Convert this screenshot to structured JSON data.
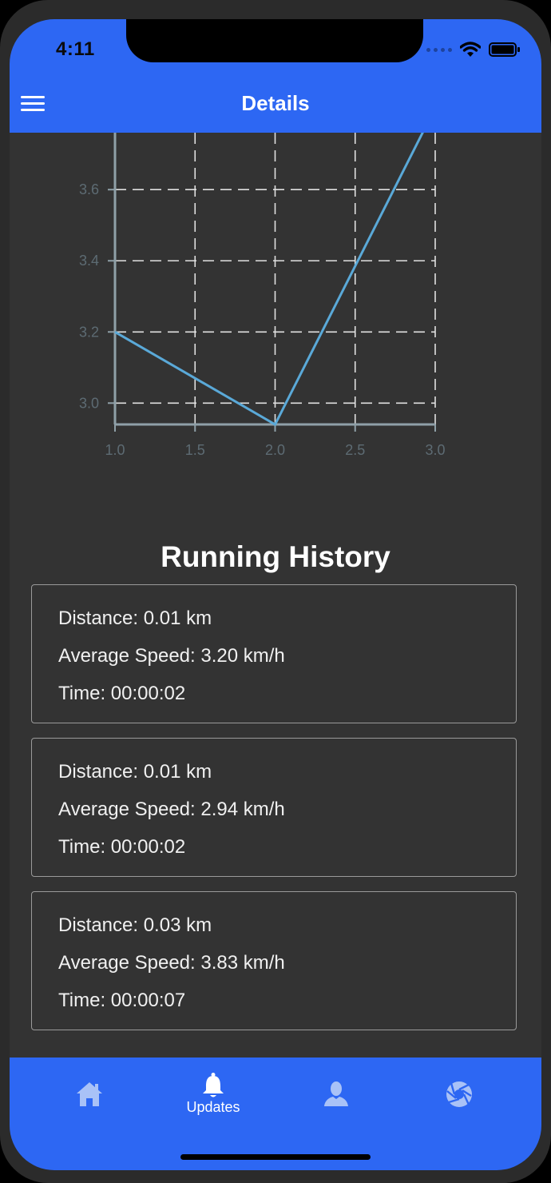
{
  "status_bar": {
    "time": "4:11"
  },
  "header": {
    "title": "Details"
  },
  "chart_data": {
    "type": "line",
    "x": [
      1.0,
      2.0,
      3.0
    ],
    "series": [
      {
        "values": [
          3.2,
          2.94,
          3.83
        ]
      }
    ],
    "x_ticks": [
      "1.0",
      "1.5",
      "2.0",
      "2.5",
      "3.0"
    ],
    "y_ticks": [
      "3.0",
      "3.2",
      "3.4",
      "3.6"
    ],
    "y_tick_values": [
      3.0,
      3.2,
      3.4,
      3.6
    ],
    "xlim": [
      1.0,
      3.0
    ],
    "ylim": [
      2.94,
      3.76
    ],
    "grid": true,
    "colors": {
      "line": "#5aa9d8",
      "grid": "#e0e0e0",
      "axis": "#8fa0a8",
      "tick_label": "#5d6b73"
    }
  },
  "history": {
    "title": "Running History",
    "runs": [
      {
        "distance": "Distance: 0.01 km",
        "speed": "Average Speed: 3.20 km/h",
        "time": "Time: 00:00:02"
      },
      {
        "distance": "Distance: 0.01 km",
        "speed": "Average Speed: 2.94 km/h",
        "time": "Time: 00:00:02"
      },
      {
        "distance": "Distance: 0.03 km",
        "speed": "Average Speed: 3.83 km/h",
        "time": "Time: 00:00:07"
      }
    ]
  },
  "tabbar": {
    "tabs": [
      {
        "icon": "home-icon",
        "label": ""
      },
      {
        "icon": "bell-icon",
        "label": "Updates",
        "active": true
      },
      {
        "icon": "person-icon",
        "label": ""
      },
      {
        "icon": "aperture-icon",
        "label": ""
      }
    ]
  },
  "colors": {
    "accent": "#2d67f3",
    "background": "#333333",
    "inactive_icon": "#a9c2f7"
  }
}
